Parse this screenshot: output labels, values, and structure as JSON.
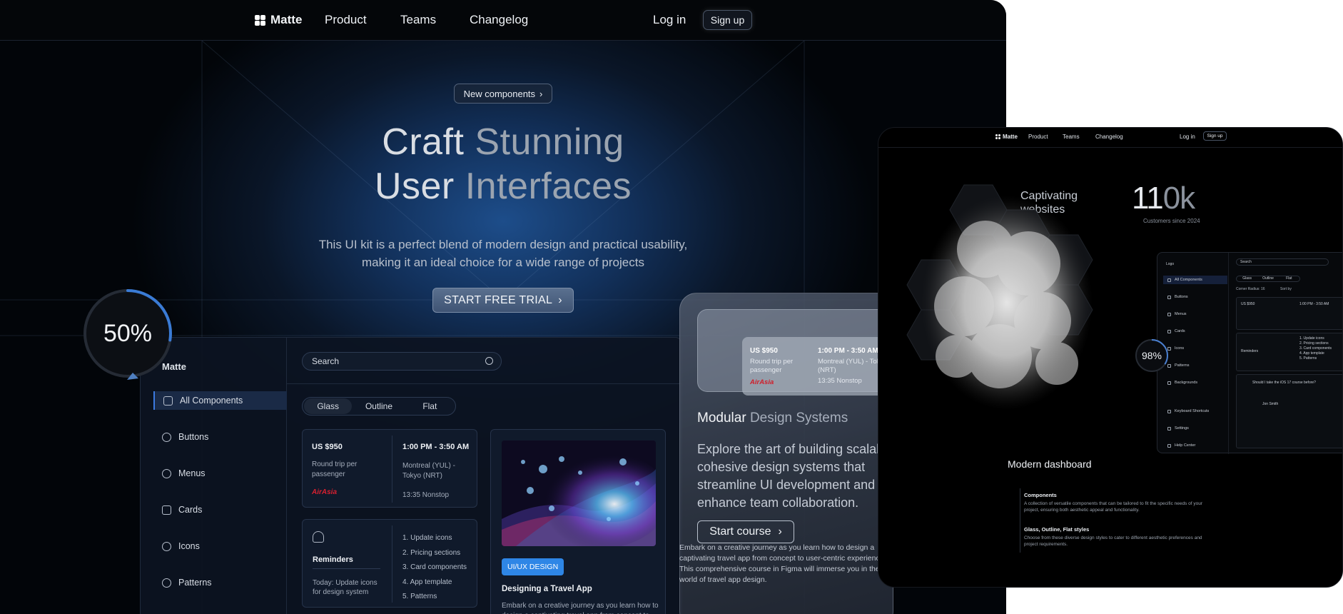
{
  "nav": {
    "logo": "Matte",
    "links": [
      "Product",
      "Teams",
      "Changelog"
    ],
    "login": "Log in",
    "signup": "Sign up"
  },
  "hero": {
    "badge": "New components",
    "title_line1_a": "Craft",
    "title_line1_b": "Stunning",
    "title_line2_a": "User",
    "title_line2_b": "Interfaces",
    "subtitle": "This UI kit is a perfect blend of modern design and practical usability, making it an ideal choice for a wide range of projects",
    "cta": "START FREE TRIAL"
  },
  "progress_ring": {
    "label": "50%",
    "value": 0.5
  },
  "app": {
    "logo": "Matte",
    "sidebar": [
      {
        "label": "All Components",
        "icon": "grid-icon",
        "active": true
      },
      {
        "label": "Buttons",
        "icon": "pointer-icon"
      },
      {
        "label": "Menus",
        "icon": "menu-icon"
      },
      {
        "label": "Cards",
        "icon": "card-icon"
      },
      {
        "label": "Icons",
        "icon": "smile-icon"
      },
      {
        "label": "Patterns",
        "icon": "pattern-icon"
      }
    ],
    "search_placeholder": "Search",
    "tabs": [
      "Glass",
      "Outline",
      "Flat"
    ],
    "active_tab": "Glass",
    "ticket": {
      "price": "US $950",
      "price_sub": "Round trip per passenger",
      "airline": "AirAsia",
      "time": "1:00 PM - 3:50 AM",
      "route": "Montreal (YUL) - Tokyo (NRT)",
      "duration": "13:35 Nonstop"
    },
    "reminders": {
      "title": "Reminders",
      "today": "Today: Update icons for design system",
      "items": [
        "1. Update icons",
        "2. Pricing sections",
        "3. Card components",
        "4. App template",
        "5. Patterns"
      ]
    },
    "course": {
      "tag": "UI/UX DESIGN",
      "title": "Designing a Travel App",
      "desc": "Embark on a creative journey as you learn how to design a captivating travel app from concept to"
    }
  },
  "glass_card": {
    "ticket": {
      "price": "US $950",
      "price_sub": "Round trip per passenger",
      "airline": "AirAsia",
      "time": "1:00 PM - 3:50 AM",
      "route": "Montreal (YUL) - Tokyo (NRT)",
      "duration": "13:35 Nonstop"
    },
    "title_a": "Modular",
    "title_b": "Design Systems",
    "desc": "Explore the art of building scalable, cohesive design systems that streamline UI development and enhance team collaboration.",
    "button": "Start course",
    "below_text": "Embark on a creative journey as you learn how to design a captivating travel app from concept to user-centric experience. This comprehensive course in Figma will immerse you in the world of travel app design."
  },
  "right_panel": {
    "nav": {
      "logo": "Matte",
      "links": [
        "Product",
        "Teams",
        "Changelog"
      ],
      "login": "Log in",
      "signup": "Sign up"
    },
    "captivating": "Captivating websites",
    "big_number_a": "11",
    "big_number_b": "0k",
    "since": "Customers since 2024",
    "ring": {
      "label": "98%",
      "value": 0.98
    },
    "modern": "Modern dashboard",
    "dashboard": {
      "logo": "Logo",
      "sidebar": [
        "All Components",
        "Buttons",
        "Menus",
        "Cards",
        "Icons",
        "Patterns",
        "Backgrounds"
      ],
      "sidebar_bottom": [
        "Keyboard Shortcuts",
        "Settings",
        "Help Center"
      ],
      "search": "Search",
      "tabs": [
        "Glass",
        "Outline",
        "Flat"
      ],
      "filter1": "Corner Radius: 16",
      "filter2": "Sort by",
      "ticket_price": "US $950",
      "ticket_time": "1:00 PM - 3:50 AM",
      "reminders": "Reminders",
      "reminder_items": [
        "1. Update icons",
        "2. Pricing sections",
        "3. Card components",
        "4. App template",
        "5. Patterns"
      ],
      "question": "Should I take the iOS 17 course before?",
      "user": "Jon Smith"
    },
    "sections": [
      {
        "title": "Components",
        "desc": "A collection of versatile components that can be tailored to fit the specific needs of your project, ensuring both aesthetic appeal and functionality."
      },
      {
        "title": "Glass, Outline, Flat styles",
        "desc": "Choose from these diverse design styles to cater to different aesthetic preferences and project requirements."
      }
    ]
  }
}
